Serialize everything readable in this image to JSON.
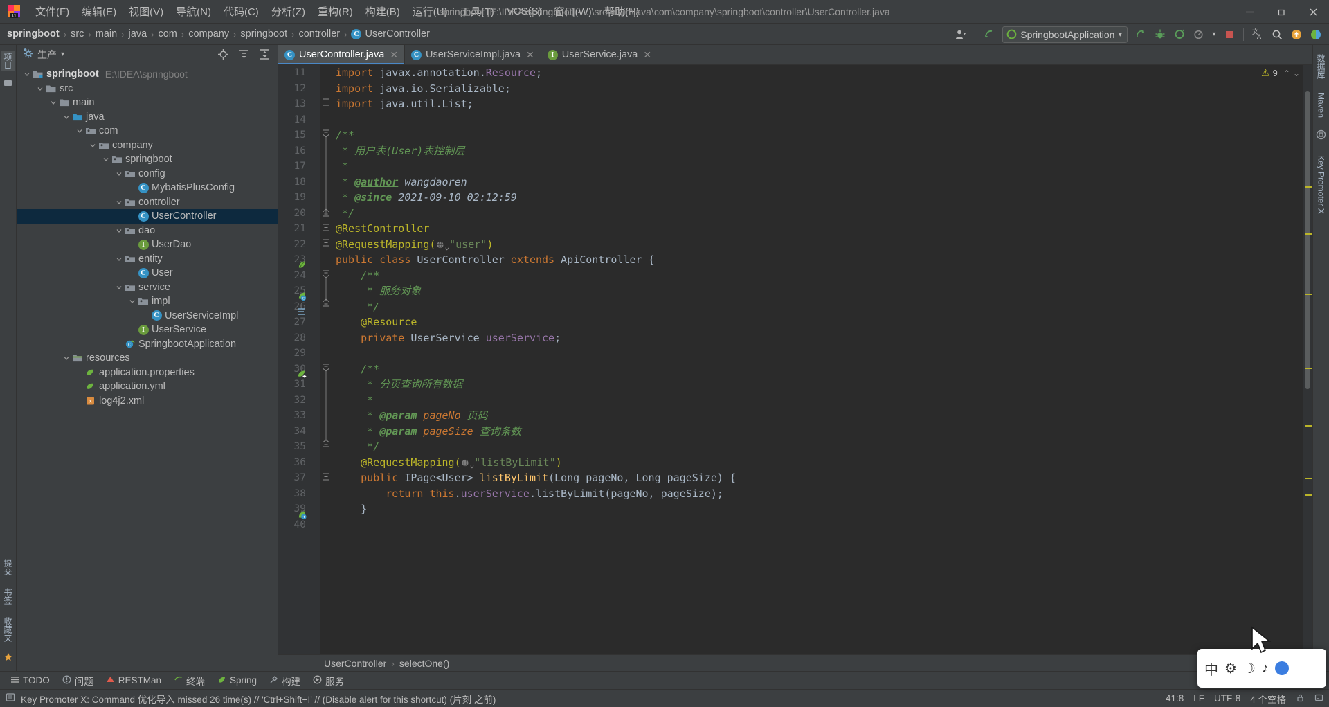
{
  "window": {
    "title": "springboot [E:\\IDEA\\springboot] - ...\\src\\main\\java\\com\\company\\springboot\\controller\\UserController.java",
    "minimize": "—",
    "maximize": "❐",
    "close": "✕"
  },
  "menu": {
    "items": [
      {
        "label": "文件(F)",
        "name": "menu-file"
      },
      {
        "label": "编辑(E)",
        "name": "menu-edit"
      },
      {
        "label": "视图(V)",
        "name": "menu-view"
      },
      {
        "label": "导航(N)",
        "name": "menu-navigate"
      },
      {
        "label": "代码(C)",
        "name": "menu-code"
      },
      {
        "label": "分析(Z)",
        "name": "menu-analyze"
      },
      {
        "label": "重构(R)",
        "name": "menu-refactor"
      },
      {
        "label": "构建(B)",
        "name": "menu-build"
      },
      {
        "label": "运行(U)",
        "name": "menu-run"
      },
      {
        "label": "工具(T)",
        "name": "menu-tools"
      },
      {
        "label": "VCS(S)",
        "name": "menu-vcs"
      },
      {
        "label": "窗口(W)",
        "name": "menu-window"
      },
      {
        "label": "帮助(H)",
        "name": "menu-help"
      }
    ]
  },
  "breadcrumb": {
    "items": [
      "springboot",
      "src",
      "main",
      "java",
      "com",
      "company",
      "springboot",
      "controller",
      "UserController"
    ],
    "separator": "›"
  },
  "toolbar": {
    "run_config": "SpringbootApplication",
    "dropdown_caret": "▾"
  },
  "project_panel": {
    "title": "生产",
    "caret": "▾",
    "tree": [
      {
        "label": "springboot",
        "sub": "E:\\IDEA\\springboot",
        "indent": 0,
        "icon": "module",
        "arrow": "expanded",
        "bold": true
      },
      {
        "label": "src",
        "sub": "",
        "indent": 1,
        "icon": "folder",
        "arrow": "expanded",
        "bold": false
      },
      {
        "label": "main",
        "sub": "",
        "indent": 2,
        "icon": "folder",
        "arrow": "expanded",
        "bold": false
      },
      {
        "label": "java",
        "sub": "",
        "indent": 3,
        "icon": "source-folder",
        "arrow": "expanded",
        "bold": false
      },
      {
        "label": "com",
        "sub": "",
        "indent": 4,
        "icon": "package",
        "arrow": "expanded",
        "bold": false
      },
      {
        "label": "company",
        "sub": "",
        "indent": 5,
        "icon": "package",
        "arrow": "expanded",
        "bold": false
      },
      {
        "label": "springboot",
        "sub": "",
        "indent": 6,
        "icon": "package",
        "arrow": "expanded",
        "bold": false
      },
      {
        "label": "config",
        "sub": "",
        "indent": 7,
        "icon": "package",
        "arrow": "expanded",
        "bold": false
      },
      {
        "label": "MybatisPlusConfig",
        "sub": "",
        "indent": 8,
        "icon": "class",
        "arrow": "none",
        "bold": false
      },
      {
        "label": "controller",
        "sub": "",
        "indent": 7,
        "icon": "package",
        "arrow": "expanded",
        "bold": false
      },
      {
        "label": "UserController",
        "sub": "",
        "indent": 8,
        "icon": "class",
        "arrow": "none",
        "bold": false,
        "selected": true
      },
      {
        "label": "dao",
        "sub": "",
        "indent": 7,
        "icon": "package",
        "arrow": "expanded",
        "bold": false
      },
      {
        "label": "UserDao",
        "sub": "",
        "indent": 8,
        "icon": "interface",
        "arrow": "none",
        "bold": false
      },
      {
        "label": "entity",
        "sub": "",
        "indent": 7,
        "icon": "package",
        "arrow": "expanded",
        "bold": false
      },
      {
        "label": "User",
        "sub": "",
        "indent": 8,
        "icon": "class",
        "arrow": "none",
        "bold": false
      },
      {
        "label": "service",
        "sub": "",
        "indent": 7,
        "icon": "package",
        "arrow": "expanded",
        "bold": false
      },
      {
        "label": "impl",
        "sub": "",
        "indent": 8,
        "icon": "package",
        "arrow": "expanded",
        "bold": false
      },
      {
        "label": "UserServiceImpl",
        "sub": "",
        "indent": 9,
        "icon": "class",
        "arrow": "none",
        "bold": false
      },
      {
        "label": "UserService",
        "sub": "",
        "indent": 8,
        "icon": "interface",
        "arrow": "none",
        "bold": false
      },
      {
        "label": "SpringbootApplication",
        "sub": "",
        "indent": 7,
        "icon": "spring-class",
        "arrow": "none",
        "bold": false
      },
      {
        "label": "resources",
        "sub": "",
        "indent": 3,
        "icon": "resource-folder",
        "arrow": "expanded",
        "bold": false
      },
      {
        "label": "application.properties",
        "sub": "",
        "indent": 4,
        "icon": "spring-file",
        "arrow": "none",
        "bold": false
      },
      {
        "label": "application.yml",
        "sub": "",
        "indent": 4,
        "icon": "spring-file",
        "arrow": "none",
        "bold": false
      },
      {
        "label": "log4j2.xml",
        "sub": "",
        "indent": 4,
        "icon": "xml-file",
        "arrow": "none",
        "bold": false
      }
    ]
  },
  "left_rail": {
    "items": [
      {
        "label": "项目",
        "name": "rail-project",
        "active": true
      },
      {
        "label": "结构",
        "name": "rail-structure",
        "active": false
      }
    ],
    "bottom": [
      {
        "label": "提交",
        "name": "rail-commit"
      },
      {
        "label": "书签",
        "name": "rail-bookmarks"
      },
      {
        "label": "收藏夹",
        "name": "rail-favorites"
      }
    ]
  },
  "right_rail": {
    "items": [
      {
        "label": "数据库",
        "name": "rail-database"
      },
      {
        "label": "Maven",
        "name": "rail-maven"
      },
      {
        "label": "Key Promoter X",
        "name": "rail-key-promoter"
      }
    ]
  },
  "editor_tabs": [
    {
      "label": "UserController.java",
      "icon": "class",
      "active": true,
      "close": "✕"
    },
    {
      "label": "UserServiceImpl.java",
      "icon": "class",
      "active": false,
      "close": "✕"
    },
    {
      "label": "UserService.java",
      "icon": "interface",
      "active": false,
      "close": "✕"
    }
  ],
  "inspection": {
    "warning_count": "9",
    "warning_icon": "⚠",
    "up_caret": "⌃",
    "down_caret": "⌄"
  },
  "editor": {
    "first_line": 11,
    "lines": [
      {
        "no": 11,
        "text": "import javax.annotation.Resource;"
      },
      {
        "no": 12,
        "text": "import java.io.Serializable;"
      },
      {
        "no": 13,
        "text": "import java.util.List;"
      },
      {
        "no": 14,
        "text": ""
      },
      {
        "no": 15,
        "text": "/**"
      },
      {
        "no": 16,
        "text": " * 用户表(User)表控制层"
      },
      {
        "no": 17,
        "text": " *"
      },
      {
        "no": 18,
        "text": " * @author wangdaoren"
      },
      {
        "no": 19,
        "text": " * @since 2021-09-10 02:12:59"
      },
      {
        "no": 20,
        "text": " */"
      },
      {
        "no": 21,
        "text": "@RestController"
      },
      {
        "no": 22,
        "text": "@RequestMapping(\"user\")"
      },
      {
        "no": 23,
        "text": "public class UserController extends ApiController {"
      },
      {
        "no": 24,
        "text": "    /**"
      },
      {
        "no": 25,
        "text": "     * 服务对象"
      },
      {
        "no": 26,
        "text": "     */"
      },
      {
        "no": 27,
        "text": "    @Resource"
      },
      {
        "no": 28,
        "text": "    private UserService userService;"
      },
      {
        "no": 29,
        "text": ""
      },
      {
        "no": 30,
        "text": "    /**"
      },
      {
        "no": 31,
        "text": "     * 分页查询所有数据"
      },
      {
        "no": 32,
        "text": "     *"
      },
      {
        "no": 33,
        "text": "     * @param pageNo 页码"
      },
      {
        "no": 34,
        "text": "     * @param pageSize 查询条数"
      },
      {
        "no": 35,
        "text": "     */"
      },
      {
        "no": 36,
        "text": "    @RequestMapping(\"listByLimit\")"
      },
      {
        "no": 37,
        "text": "    public IPage<User> listByLimit(Long pageNo, Long pageSize) {"
      },
      {
        "no": 38,
        "text": "        return this.userService.listByLimit(pageNo, pageSize);"
      },
      {
        "no": 39,
        "text": "    }"
      },
      {
        "no": 40,
        "text": ""
      }
    ],
    "annotations": {
      "author_tag": "@author",
      "author_value": "wangdaoren",
      "since_tag": "@since",
      "since_value": "2021-09-10 02:12:59",
      "request_mapping_user": "user",
      "request_mapping_list": "listByLimit"
    }
  },
  "editor_breadcrumb": {
    "items": [
      "UserController",
      "selectOne()"
    ],
    "separator": "›"
  },
  "bottom_tools": [
    {
      "label": "TODO",
      "name": "tool-todo",
      "icon": "list-icon"
    },
    {
      "label": "问题",
      "name": "tool-problems",
      "icon": "problems-icon"
    },
    {
      "label": "RESTMan",
      "name": "tool-restman",
      "icon": "restman-icon"
    },
    {
      "label": "终端",
      "name": "tool-terminal",
      "icon": "terminal-icon"
    },
    {
      "label": "Spring",
      "name": "tool-spring",
      "icon": "spring-icon"
    },
    {
      "label": "构建",
      "name": "tool-build",
      "icon": "build-icon"
    },
    {
      "label": "服务",
      "name": "tool-services",
      "icon": "services-icon"
    }
  ],
  "statusbar": {
    "message": "Key Promoter X: Command 优化导入 missed 26 time(s) // 'Ctrl+Shift+I' // (Disable alert for this shortcut) (片刻 之前)",
    "caret_position": "41:8",
    "line_separator": "LF",
    "encoding": "UTF-8",
    "indent": "4 个空格",
    "lock_icon": "🔒"
  },
  "ime": {
    "mode": "中",
    "items": [
      "中",
      "⚙",
      "☽",
      "♪"
    ],
    "badge": "logo"
  },
  "colors": {
    "accent": "#4a88c7",
    "selection": "#0d293e",
    "editor_bg": "#2b2b2b",
    "panel_bg": "#3c3f41",
    "gutter_bg": "#313335",
    "keyword": "#cc7832",
    "annotation": "#bbb529",
    "string": "#6a8759",
    "comment": "#629755",
    "field": "#9876aa",
    "method": "#ffc66d",
    "warning": "#bbb529"
  }
}
